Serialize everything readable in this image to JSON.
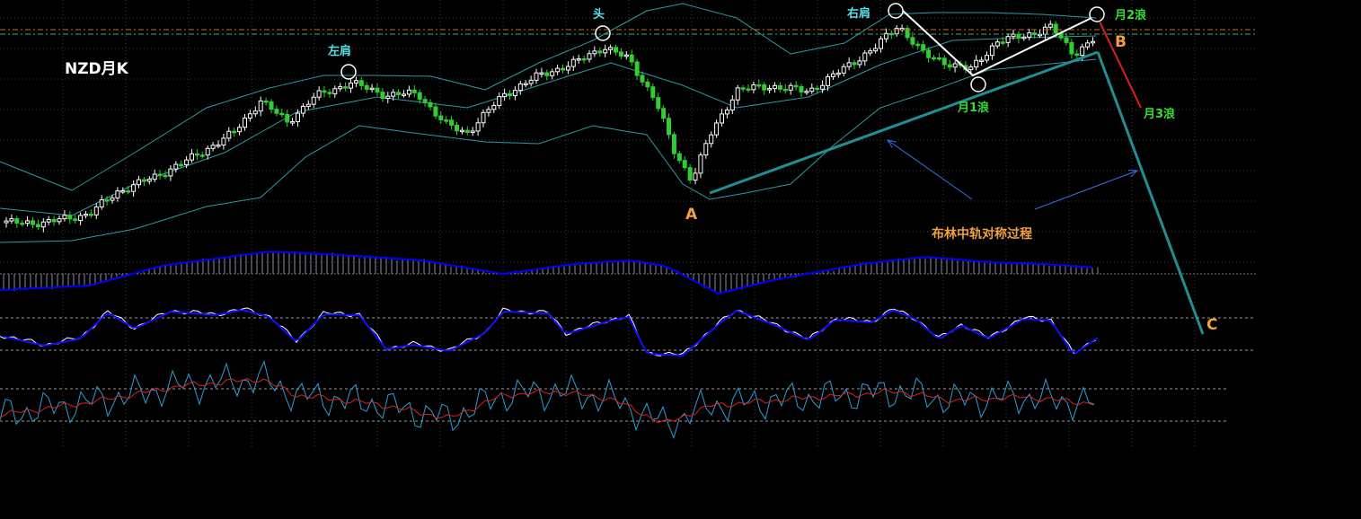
{
  "title": "NZD月K",
  "colors": {
    "background": "#000000",
    "grid": "#3a3a3a",
    "bull_candle": "#ffffff",
    "bear_candle": "#33cc33",
    "bollinger": "#2e9aa0",
    "hline_orange": "#d2691e",
    "hline_green": "#3cb371",
    "trend_teal": "#1f8f93",
    "pattern_white": "#ffffff",
    "red_line": "#e02020",
    "arrow_blue": "#3a6ee8",
    "label_cyan": "#55e0e8",
    "label_green": "#33dd33",
    "label_orange": "#f0a040",
    "macd_line": "#0000ff",
    "stoch_k": "#ffffff",
    "stoch_d": "#1010ff",
    "osc_fast": "#2a9fd8",
    "osc_slow": "#e02020"
  },
  "chart_data": {
    "type": "candlestick",
    "title": "NZD月K",
    "annotations": {
      "left_shoulder": "左肩",
      "head": "头",
      "right_shoulder": "右肩",
      "point_a": "A",
      "point_b": "B",
      "point_c": "C",
      "wave1": "月1浪",
      "wave2": "月2浪",
      "wave3": "月3浪",
      "note": "布林中轨对称过程"
    },
    "indicators": [
      "MACD",
      "Stochastic",
      "Oscillator"
    ]
  }
}
